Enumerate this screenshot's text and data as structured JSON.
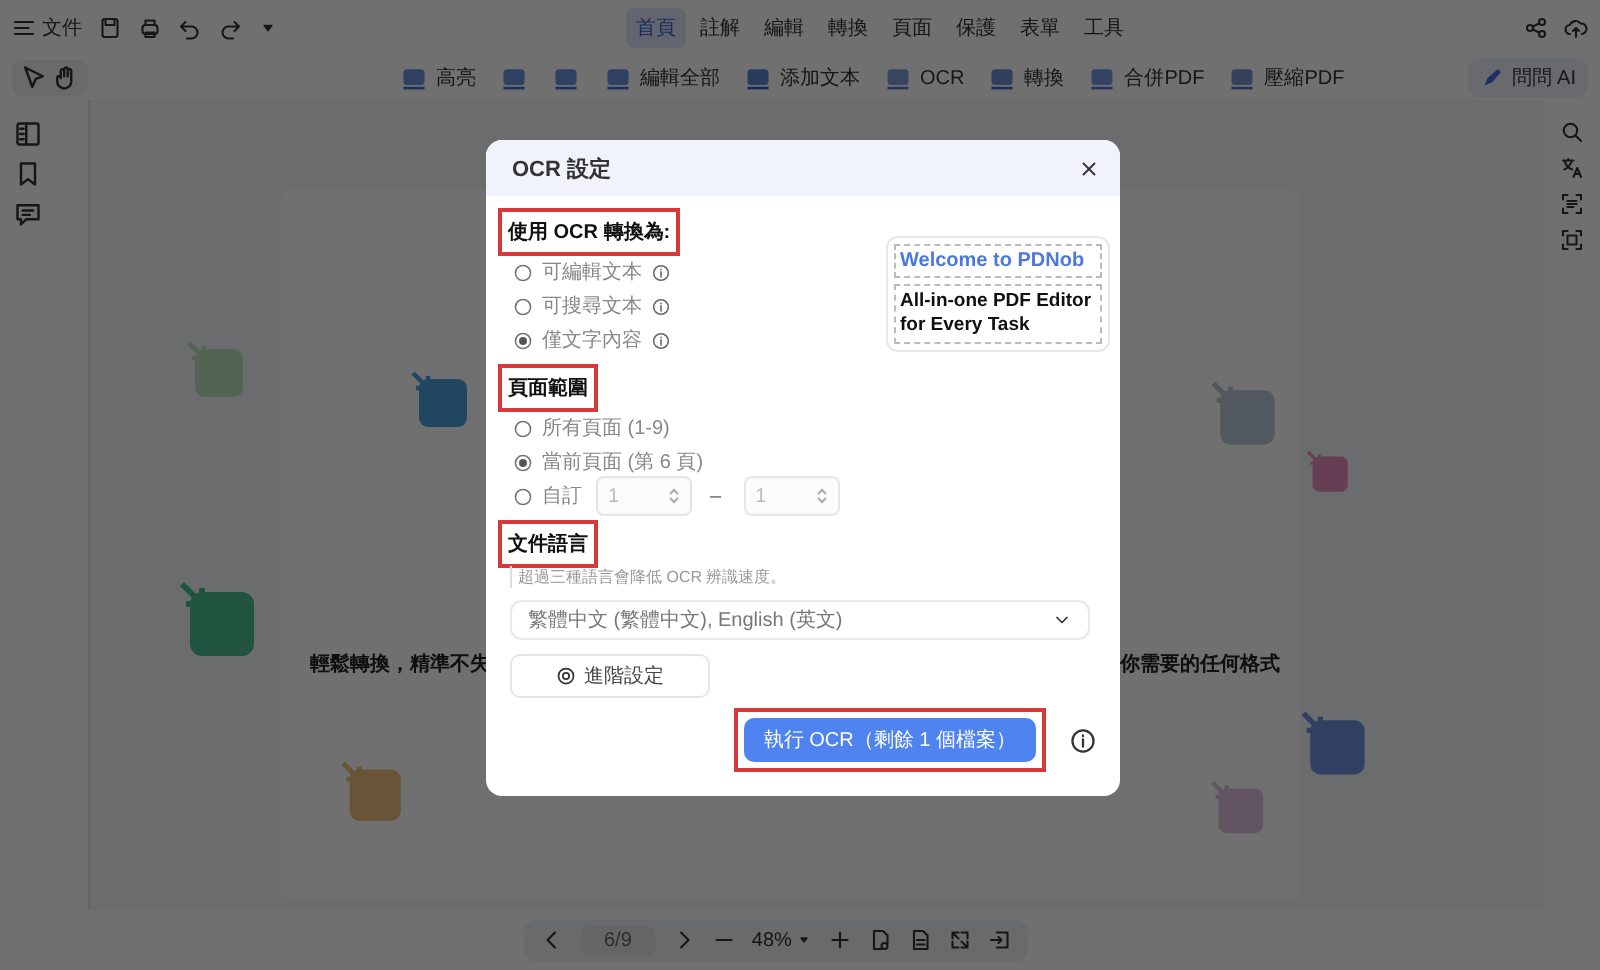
{
  "menu_bar": {
    "file_label": "文件",
    "tabs": [
      {
        "label": "首頁",
        "selected": true
      },
      {
        "label": "註解",
        "selected": false
      },
      {
        "label": "編輯",
        "selected": false
      },
      {
        "label": "轉換",
        "selected": false
      },
      {
        "label": "頁面",
        "selected": false
      },
      {
        "label": "保護",
        "selected": false
      },
      {
        "label": "表單",
        "selected": false
      },
      {
        "label": "工具",
        "selected": false
      }
    ]
  },
  "toolbar": {
    "tools": [
      {
        "kind": "labeled",
        "label": "高亮"
      },
      {
        "kind": "icon"
      },
      {
        "kind": "icon"
      },
      {
        "kind": "labeled",
        "label": "編輯全部"
      },
      {
        "kind": "labeled",
        "label": "添加文本"
      },
      {
        "kind": "labeled",
        "label": "OCR"
      },
      {
        "kind": "labeled",
        "label": "轉換"
      },
      {
        "kind": "labeled",
        "label": "合併PDF"
      },
      {
        "kind": "labeled",
        "label": "壓縮PDF"
      }
    ],
    "ai_button": "問問 AI"
  },
  "document": {
    "headings": [
      "輕鬆轉換，精準不失",
      "你需要的任何格式"
    ]
  },
  "page_nav": {
    "page": "6/9",
    "zoom": "48%"
  },
  "dialog": {
    "title": "OCR 設定",
    "sections": [
      {
        "heading": "使用 OCR 轉換為:",
        "annotated": true,
        "options": [
          {
            "kind": "radio",
            "label": "可編輯文本",
            "info": true,
            "selected": false
          },
          {
            "kind": "radio",
            "label": "可搜尋文本",
            "info": true,
            "selected": false
          },
          {
            "kind": "radio",
            "label": "僅文字內容",
            "info": true,
            "selected": true
          }
        ]
      },
      {
        "heading": "頁面範圍",
        "annotated": true,
        "options": [
          {
            "kind": "radio",
            "label": "所有頁面 (1-9)",
            "info": false,
            "selected": false
          },
          {
            "kind": "radio",
            "label": "當前頁面 (第 6 頁)",
            "info": false,
            "selected": true
          },
          {
            "kind": "range",
            "label": "自訂",
            "info": false,
            "selected": false,
            "from": "1",
            "separator": "–",
            "to": "1",
            "disabled": true
          }
        ]
      },
      {
        "heading": "文件語言",
        "annotated": true,
        "hint": "超過三種語言會降低 OCR 辨識速度。",
        "select": "繁體中文 (繁體中文), English (英文)"
      }
    ],
    "promo": {
      "title": "Welcome to PDNob",
      "subtitle": "All-in-one PDF Editor for Every Task"
    },
    "advanced_button": "進階設定",
    "run_button": {
      "label": "執行 OCR（剩餘 1 個檔案）",
      "annotated": true
    }
  }
}
